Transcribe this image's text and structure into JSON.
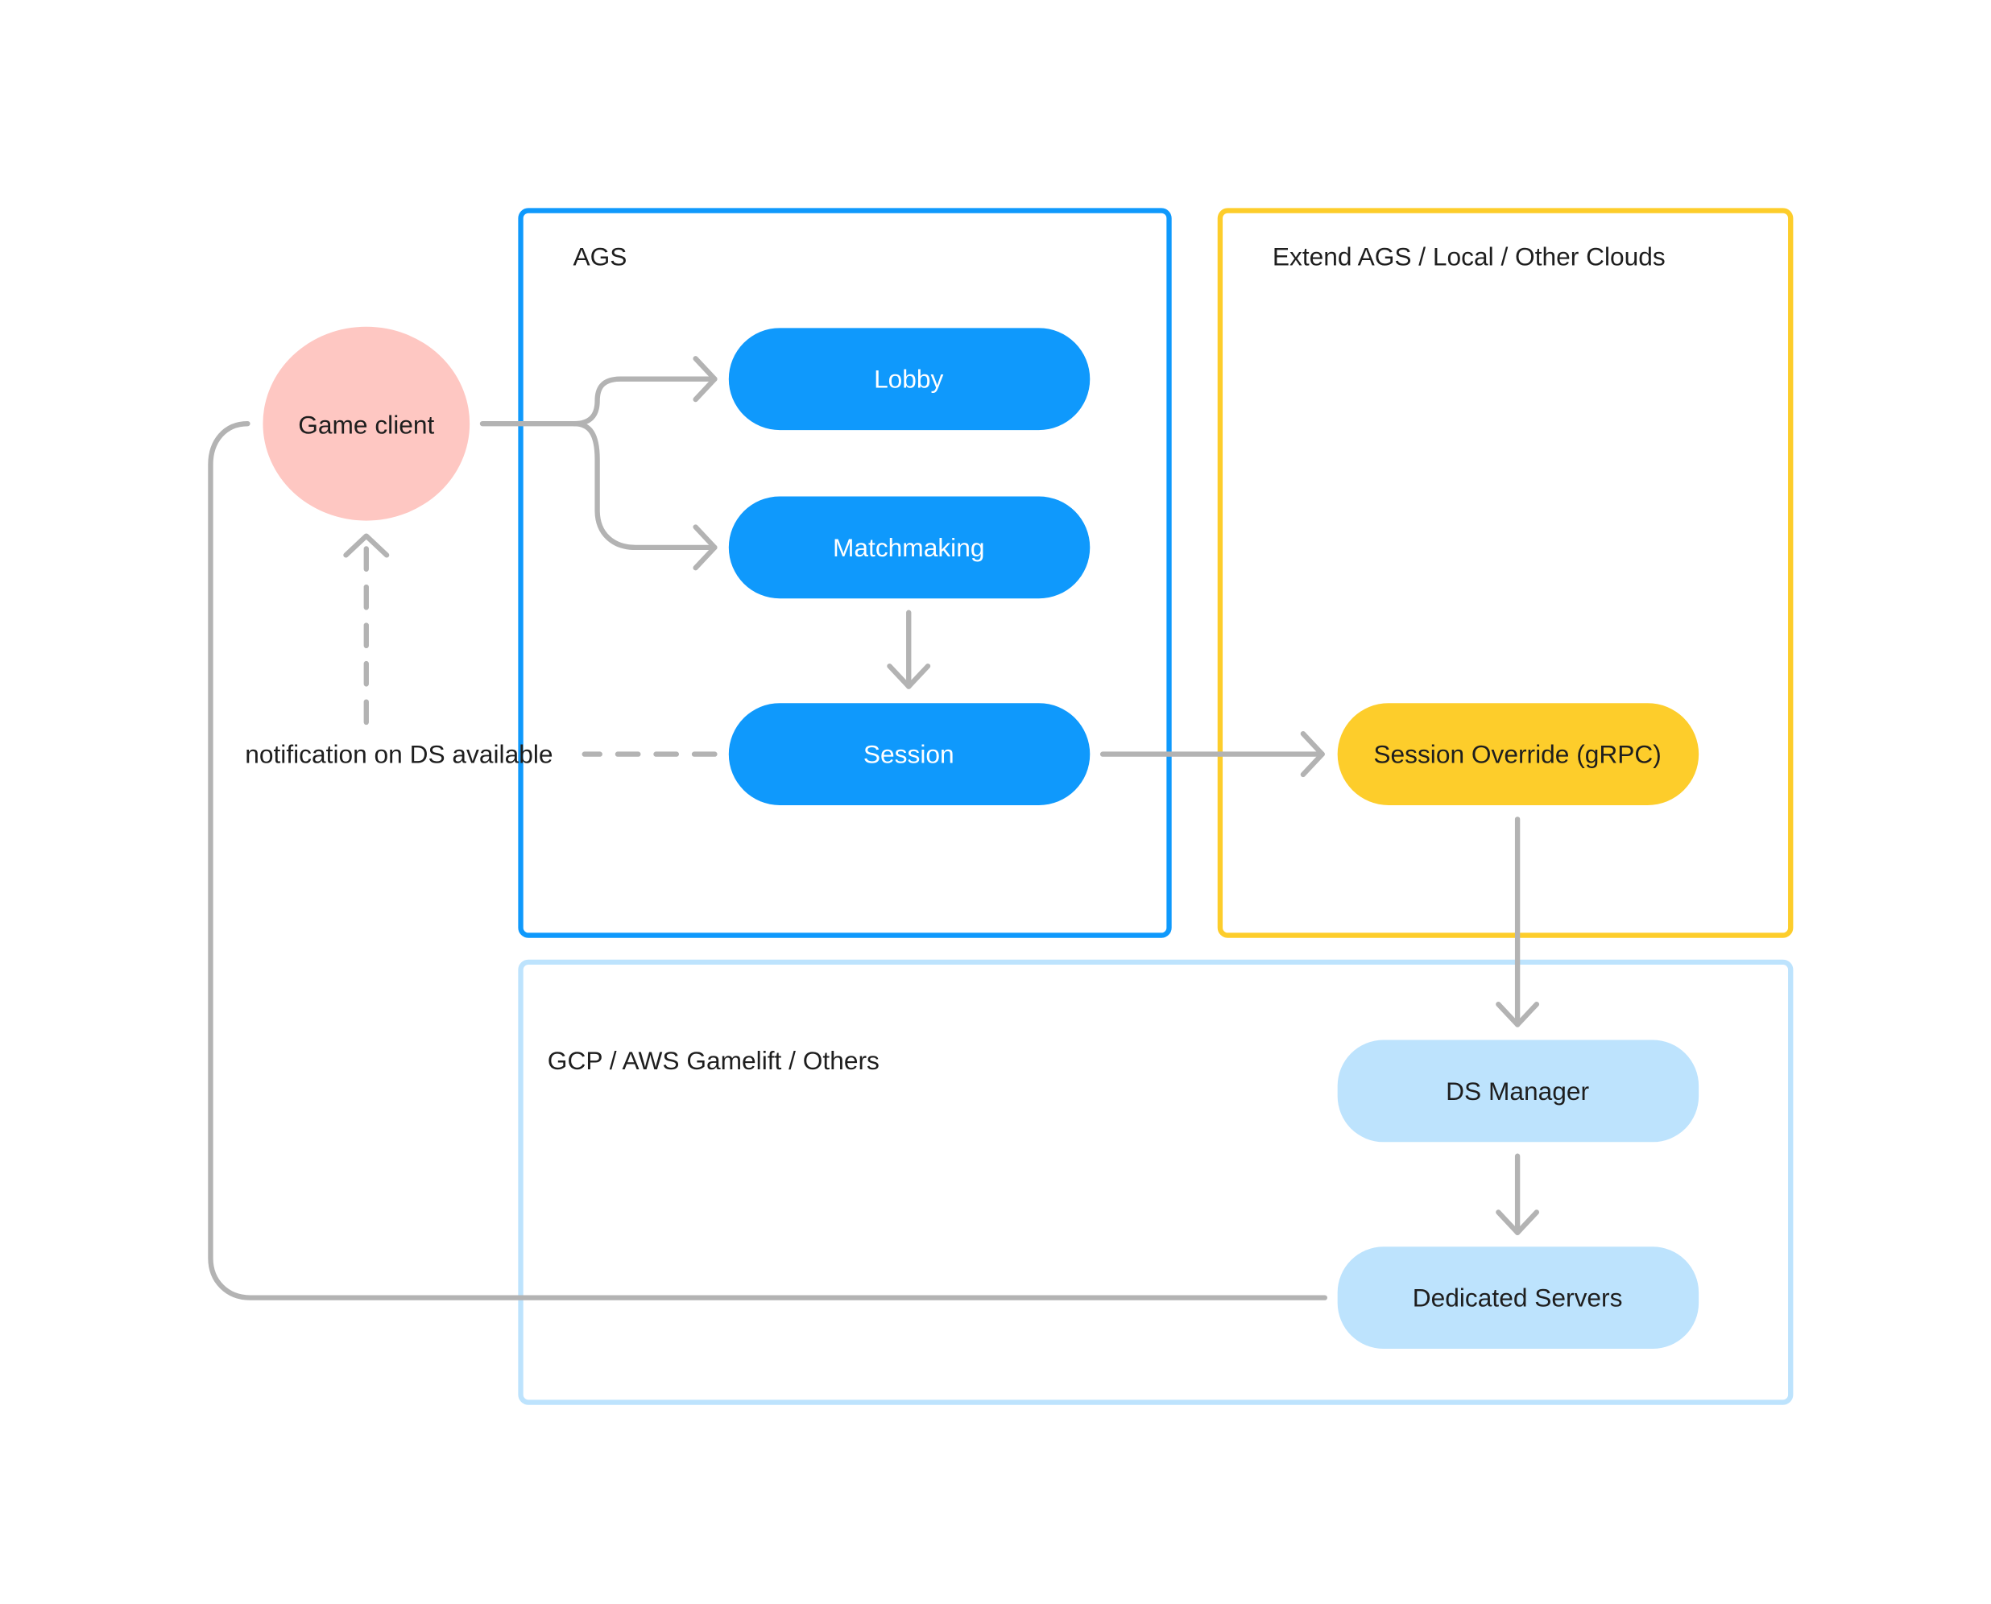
{
  "colors": {
    "ags_border": "#0f99fc",
    "extend_border": "#fdcd2b",
    "cloud_border": "#bde3fd",
    "ags_node": "#0f99fc",
    "extend_node": "#fdcd2b",
    "cloud_node": "#bde3fd",
    "client_node": "#fec7c2",
    "connector": "#b3b3b3",
    "text_dark": "#1e1e1e",
    "text_light": "#ffffff"
  },
  "groups": {
    "ags": {
      "label": "AGS"
    },
    "extend": {
      "label": "Extend AGS / Local / Other Clouds"
    },
    "cloud": {
      "label": "GCP / AWS Gamelift / Others"
    }
  },
  "nodes": {
    "game_client": {
      "label": "Game client"
    },
    "lobby": {
      "label": "Lobby"
    },
    "matchmaking": {
      "label": "Matchmaking"
    },
    "session": {
      "label": "Session"
    },
    "session_override": {
      "label": "Session Override (gRPC)"
    },
    "ds_manager": {
      "label": "DS Manager"
    },
    "dedicated_servers": {
      "label": "Dedicated Servers"
    }
  },
  "edges": {
    "notification": {
      "label": "notification on DS available"
    }
  }
}
